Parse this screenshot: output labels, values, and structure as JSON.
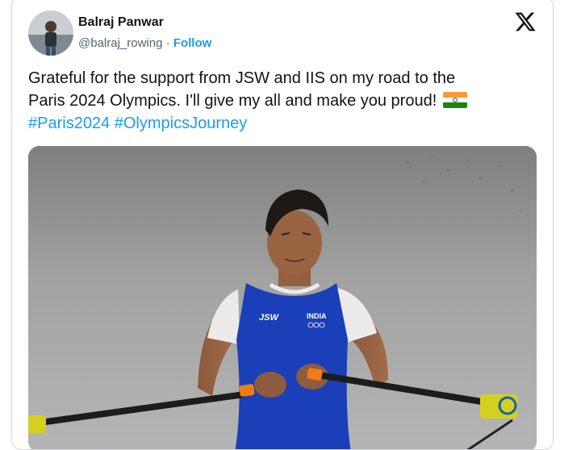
{
  "tweet": {
    "author_name": "Balraj Panwar",
    "handle": "@balraj_rowing",
    "separator": " · ",
    "follow_label": "Follow",
    "text_line1": "Grateful for the support from JSW and IIS on my road to the",
    "text_line2": "Paris 2024 Olympics. I'll give my all and make you proud!",
    "hashtags": [
      "#Paris2024",
      "#OlympicsJourney"
    ],
    "flag_icon": "india-flag-emoji"
  },
  "photo": {
    "vest_brand": "JSW",
    "vest_country": "INDIA"
  },
  "colors": {
    "link": "#1d9bf0",
    "text": "#0f1419",
    "muted": "#536471",
    "border": "#cfd9de",
    "vest_blue": "#1b3fb8",
    "oar_yellow": "#d4d020",
    "grip_orange": "#f07c16"
  }
}
